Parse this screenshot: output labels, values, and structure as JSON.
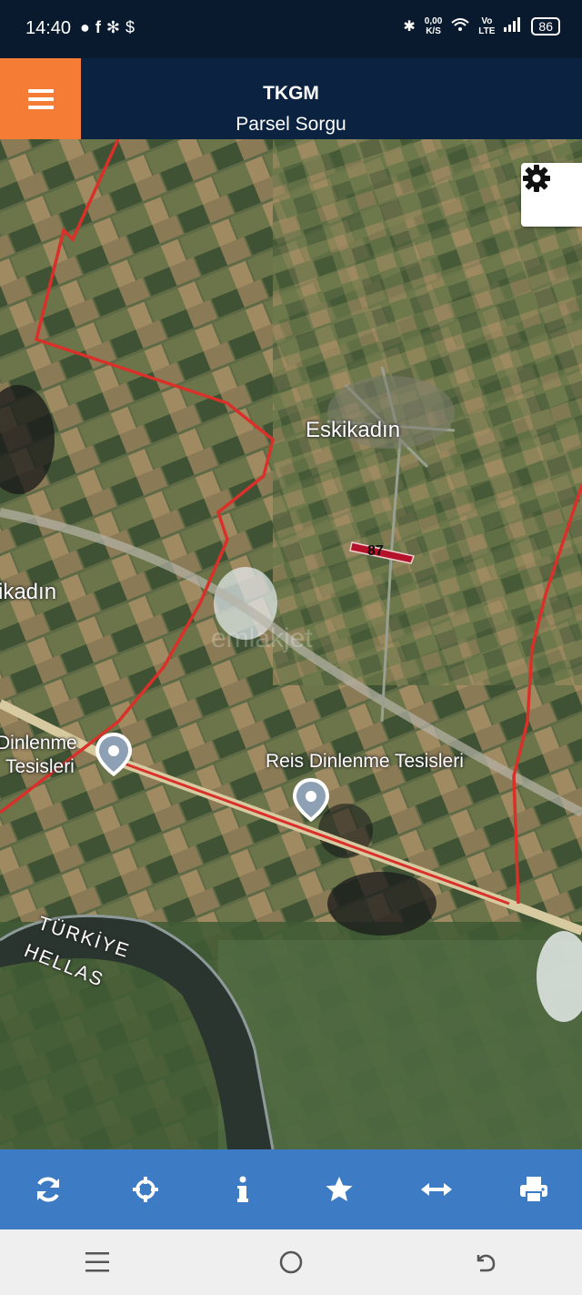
{
  "status_bar": {
    "time": "14:40",
    "left_icons": [
      "circle-notification-icon",
      "facebook-icon",
      "pinwheel-icon",
      "dollar-icon"
    ],
    "net_speed_value": "0,00",
    "net_speed_unit": "K/S",
    "volte_top": "Vo",
    "volte_bottom": "LTE",
    "battery": "86"
  },
  "header": {
    "title": "TKGM",
    "subtitle": "Parsel Sorgu",
    "menu_color": "#f57c34"
  },
  "map": {
    "labels": {
      "village": "Eskikadın",
      "village_partial": "ikadın",
      "poi_left_1": "Dinlenme",
      "poi_left_2": "Tesisleri",
      "poi_main": "Reis Dinlenme Tesisleri",
      "border_1": "TÜRKİYE",
      "border_2": "HELLAS",
      "parcel": "87",
      "watermark": "emlakjet"
    },
    "boundary_color": "#d9302a"
  },
  "toolbar": {
    "buttons": [
      {
        "name": "refresh-button",
        "icon": "refresh-icon"
      },
      {
        "name": "locate-button",
        "icon": "crosshair-icon"
      },
      {
        "name": "info-button",
        "icon": "info-icon"
      },
      {
        "name": "favorite-button",
        "icon": "star-icon"
      },
      {
        "name": "measure-button",
        "icon": "arrows-horizontal-icon"
      },
      {
        "name": "print-button",
        "icon": "printer-icon"
      }
    ],
    "color": "#3d7cc4"
  },
  "nav_bar": {
    "buttons": [
      "recents-icon",
      "home-icon",
      "back-icon"
    ]
  }
}
